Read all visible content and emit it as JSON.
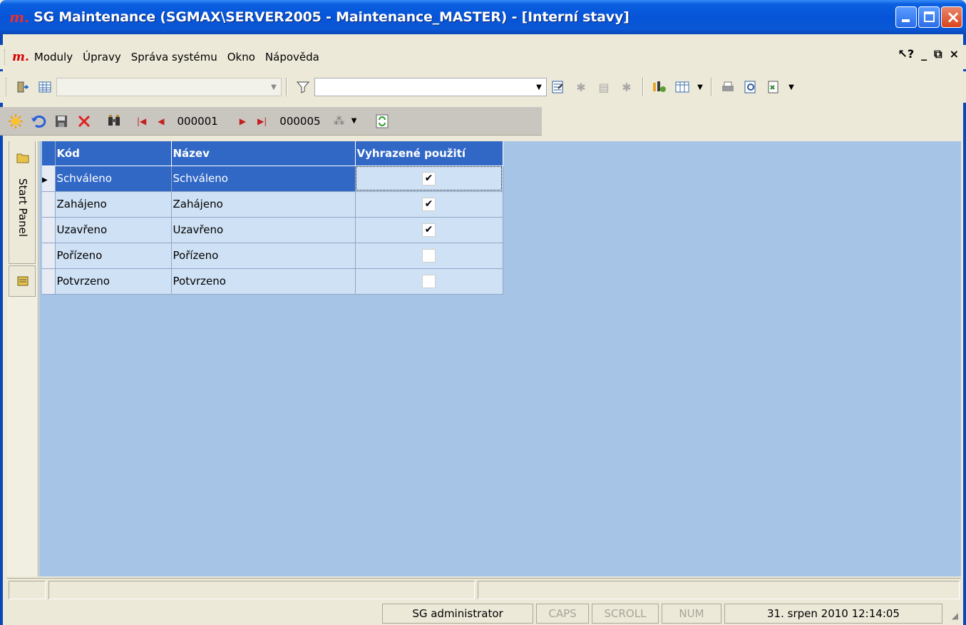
{
  "window": {
    "logo": "m.",
    "title": "SG Maintenance (SGMAX\\SERVER2005 - Maintenance_MASTER) - [Interní stavy]"
  },
  "menu": {
    "logo": "m.",
    "items": [
      "Moduly",
      "Úpravy",
      "Správa systému",
      "Okno",
      "Nápověda"
    ],
    "help_glyph": "↖?",
    "min_glyph": "_",
    "restore_glyph": "т",
    "close_glyph": "×"
  },
  "toolbar1": {
    "view_combo_value": "",
    "filter_combo_value": ""
  },
  "toolbar2": {
    "current_record": "000001",
    "total_records": "000005"
  },
  "side_panel": {
    "tab_label": "Start Panel"
  },
  "grid": {
    "columns": [
      "Kód",
      "Název",
      "Vyhrazené použití"
    ],
    "rows": [
      {
        "kod": "Schváleno",
        "nazev": "Schváleno",
        "vyhrazene": true,
        "check": "✔"
      },
      {
        "kod": "Zahájeno",
        "nazev": "Zahájeno",
        "vyhrazene": true,
        "check": "✔"
      },
      {
        "kod": "Uzavřeno",
        "nazev": "Uzavřeno",
        "vyhrazene": true,
        "check": "✔"
      },
      {
        "kod": "Pořízeno",
        "nazev": "Pořízeno",
        "vyhrazene": false,
        "check": ""
      },
      {
        "kod": "Potvrzeno",
        "nazev": "Potvrzeno",
        "vyhrazene": false,
        "check": ""
      }
    ],
    "selected_row": 0
  },
  "statusbar": {
    "user": "SG administrator",
    "caps": "CAPS",
    "scroll": "SCROLL",
    "num": "NUM",
    "datetime": "31. srpen 2010 12:14:05"
  },
  "colors": {
    "title_blue": "#0654d8",
    "workspace": "#a6c5e6",
    "header_blue": "#3168c6",
    "row_bg": "#cfe1f5"
  }
}
